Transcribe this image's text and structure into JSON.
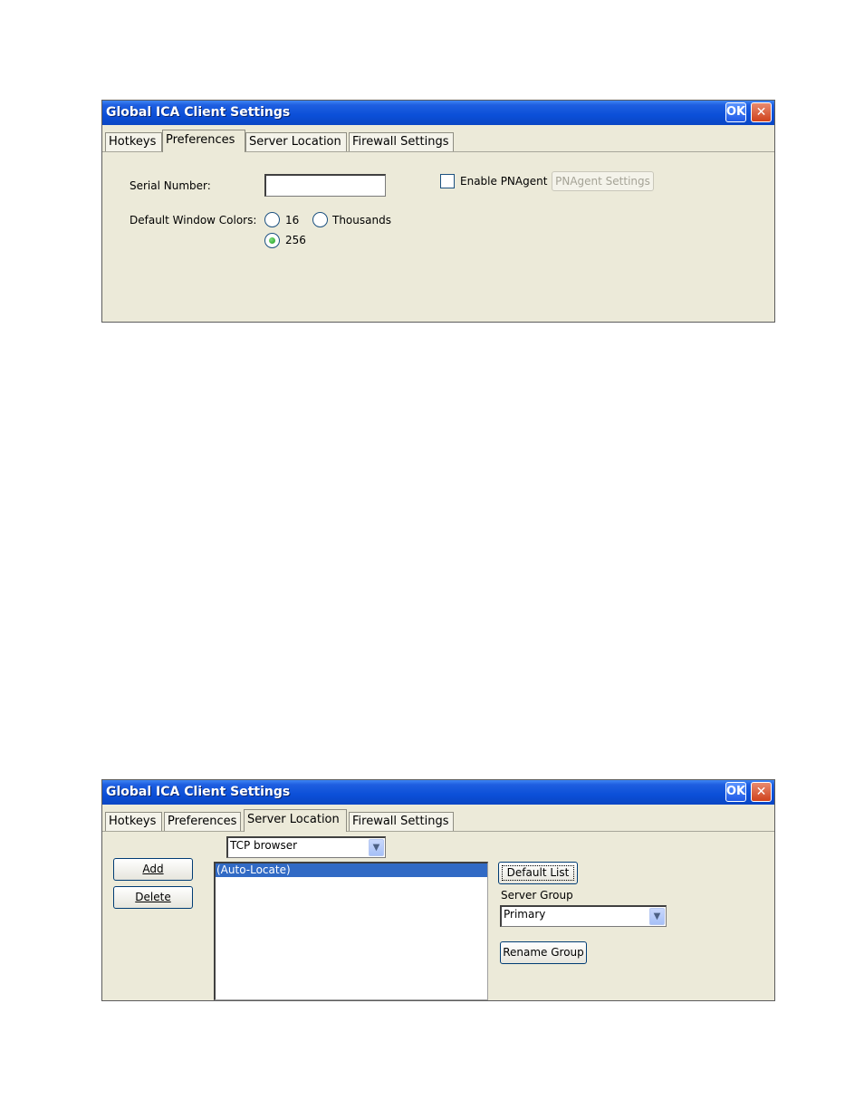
{
  "dialog1": {
    "title": "Global ICA Client Settings",
    "ok_label": "OK",
    "close_glyph": "✕",
    "tabs": [
      "Hotkeys",
      "Preferences",
      "Server Location",
      "Firewall Settings"
    ],
    "active_tab": "Preferences",
    "serial_label": "Serial Number:",
    "serial_value": "",
    "colors_label": "Default Window Colors:",
    "radio_16": "16",
    "radio_thousands": "Thousands",
    "radio_256": "256",
    "selected_color": "256",
    "enable_pnagent_label": "Enable PNAgent",
    "pnagent_settings_label": "PNAgent Settings"
  },
  "dialog2": {
    "title": "Global ICA Client Settings",
    "ok_label": "OK",
    "close_glyph": "✕",
    "tabs": [
      "Hotkeys",
      "Preferences",
      "Server Location",
      "Firewall Settings"
    ],
    "active_tab": "Server Location",
    "browser_protocol": "TCP browser",
    "add_label": "Add",
    "delete_label": "Delete",
    "server_list": [
      "(Auto-Locate)"
    ],
    "default_list_label": "Default List",
    "server_group_label": "Server Group",
    "server_group_value": "Primary",
    "rename_group_label": "Rename Group"
  },
  "icons": {
    "dropdown_arrow": "chevron-down-icon",
    "close": "close-icon"
  },
  "colors": {
    "titlebar": "#0b4fd8",
    "dialog_bg": "#ecead9",
    "selection": "#316ac5",
    "radio_selected": "#1c9c1c"
  }
}
